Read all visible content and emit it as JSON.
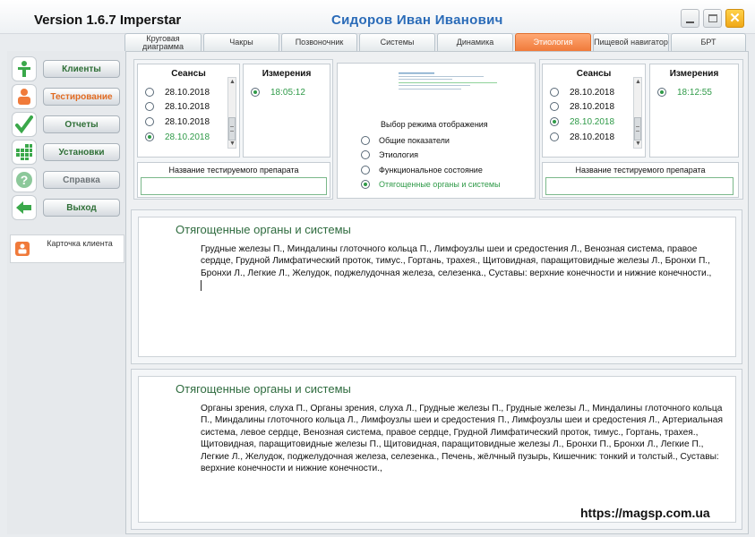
{
  "window": {
    "version_title": "Version 1.6.7 Imperstar",
    "patient_name": "Сидоров  Иван  Иванович",
    "minimize_icon": "minimize-icon",
    "maximize_icon": "maximize-icon",
    "close_icon": "close-icon",
    "close_color": "#f0a818"
  },
  "tabs": [
    {
      "label": "Круговая диаграмма",
      "active": false
    },
    {
      "label": "Чакры",
      "active": false
    },
    {
      "label": "Позвоночник",
      "active": false
    },
    {
      "label": "Системы",
      "active": false
    },
    {
      "label": "Динамика",
      "active": false
    },
    {
      "label": "Этиология",
      "active": true
    },
    {
      "label": "Пищевой навигатор",
      "active": false
    },
    {
      "label": "БРТ",
      "active": false
    }
  ],
  "sidebar": {
    "items": [
      {
        "label": "Клиенты",
        "icon": "person-icon",
        "state": "normal"
      },
      {
        "label": "Тестирование",
        "icon": "person-orange-icon",
        "state": "active"
      },
      {
        "label": "Отчеты",
        "icon": "checkmark-icon",
        "state": "normal"
      },
      {
        "label": "Установки",
        "icon": "grid-icon",
        "state": "normal"
      },
      {
        "label": "Справка",
        "icon": "question-icon",
        "state": "disabled"
      },
      {
        "label": "Выход",
        "icon": "exit-arrow-icon",
        "state": "normal"
      }
    ],
    "client_card_label": "Карточка клиента",
    "accent_green": "#3aa84a",
    "accent_orange": "#f07a3a"
  },
  "left_session": {
    "sessions_title": "Сеансы",
    "sessions": [
      {
        "date": "28.10.2018",
        "selected": false
      },
      {
        "date": "28.10.2018",
        "selected": false
      },
      {
        "date": "28.10.2018",
        "selected": false
      },
      {
        "date": "28.10.2018",
        "selected": true
      }
    ],
    "measurements_title": "Измерения",
    "measurements": [
      {
        "time": "18:05:12",
        "selected": true
      }
    ],
    "drug_label": "Название тестируемого препарата",
    "drug_value": ""
  },
  "display_mode": {
    "title": "Выбор режима отображения",
    "options": [
      {
        "label": "Общие показатели",
        "selected": false
      },
      {
        "label": "Этиология",
        "selected": false
      },
      {
        "label": "Функциональное состояние",
        "selected": false
      },
      {
        "label": "Отягощенные органы и системы",
        "selected": true
      }
    ]
  },
  "right_session": {
    "sessions_title": "Сеансы",
    "sessions": [
      {
        "date": "28.10.2018",
        "selected": false
      },
      {
        "date": "28.10.2018",
        "selected": false
      },
      {
        "date": "28.10.2018",
        "selected": true
      },
      {
        "date": "28.10.2018",
        "selected": false
      }
    ],
    "measurements_title": "Измерения",
    "measurements": [
      {
        "time": "18:12:55",
        "selected": true
      }
    ],
    "drug_label": "Название тестируемого препарата",
    "drug_value": ""
  },
  "result_top": {
    "heading": "Отягощенные органы и системы",
    "body": "Грудные железы П., Миндалины глоточного кольца П., Лимфоузлы шеи и средостения Л., Венозная система, правое сердце, Грудной Лимфатический проток, тимус., Гортань, трахея., Щитовидная, паращитовидные железы Л., Бронхи П., Бронхи Л., Легкие Л., Желудок, поджелудочная железа, селезенка., Суставы: верхние конечности и нижние конечности.,"
  },
  "result_bottom": {
    "heading": "Отягощенные органы и системы",
    "body": "Органы зрения, слуха П., Органы зрения, слуха Л., Грудные железы П., Грудные железы Л., Миндалины глоточного кольца П., Миндалины глоточного кольца Л., Лимфоузлы шеи и средостения П., Лимфоузлы шеи и средостения Л., Артериальная система, левое сердце, Венозная система, правое сердце, Грудной Лимфатический проток, тимус., Гортань, трахея., Щитовидная, паращитовидные железы П., Щитовидная, паращитовидные железы Л., Бронхи П., Бронхи Л., Легкие П., Легкие Л., Желудок, поджелудочная железа, селезенка., Печень, жёлчный пузырь, Кишечник: тонкий и толстый., Суставы: верхние конечности и нижние конечности.,"
  },
  "watermark": "https://magsp.com.ua"
}
